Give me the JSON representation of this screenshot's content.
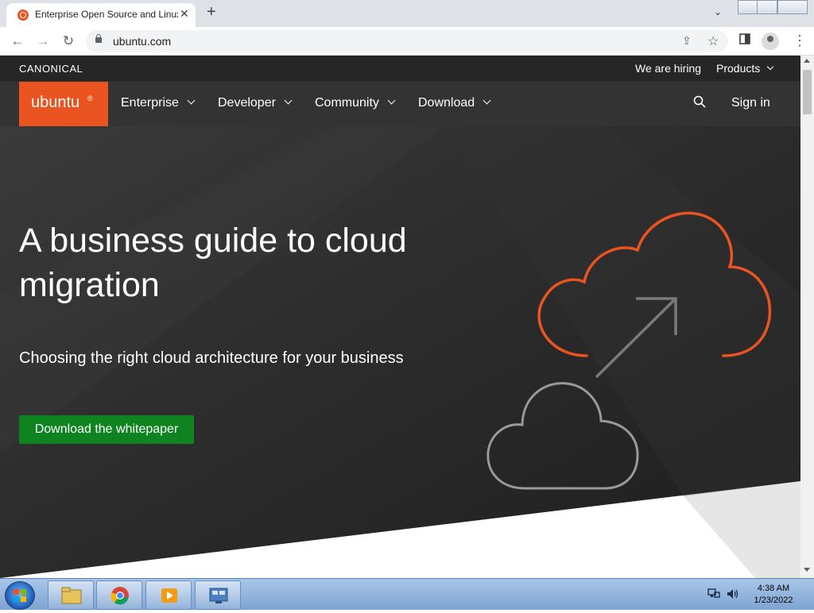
{
  "browser": {
    "tab_title": "Enterprise Open Source and Linux",
    "tab_close": "✕",
    "new_tab": "+",
    "tab_search": "⌄",
    "url": "ubuntu.com",
    "back": "←",
    "forward": "→",
    "reload": "↻",
    "share": "⇪",
    "bookmark": "☆",
    "menu": "⋮"
  },
  "page": {
    "canonical_brand": "CANONICAL",
    "top_links": {
      "hiring": "We are hiring",
      "products": "Products"
    },
    "logo_text": "ubuntu",
    "logo_mark": "®",
    "nav": {
      "enterprise": "Enterprise",
      "developer": "Developer",
      "community": "Community",
      "download": "Download"
    },
    "sign_in": "Sign in",
    "search_icon": "search-icon",
    "hero": {
      "title": "A business guide to cloud migration",
      "subtitle": "Choosing the right cloud architecture for your business",
      "cta": "Download the whitepaper"
    },
    "colors": {
      "brand": "#e95420",
      "cta": "#0e8420",
      "nav_bg": "#333333",
      "top_bg": "#262626"
    }
  },
  "taskbar": {
    "time": "4:38 AM",
    "date": "1/23/2022",
    "apps": [
      "file-explorer-icon",
      "chrome-icon",
      "media-player-icon",
      "control-panel-icon"
    ]
  }
}
